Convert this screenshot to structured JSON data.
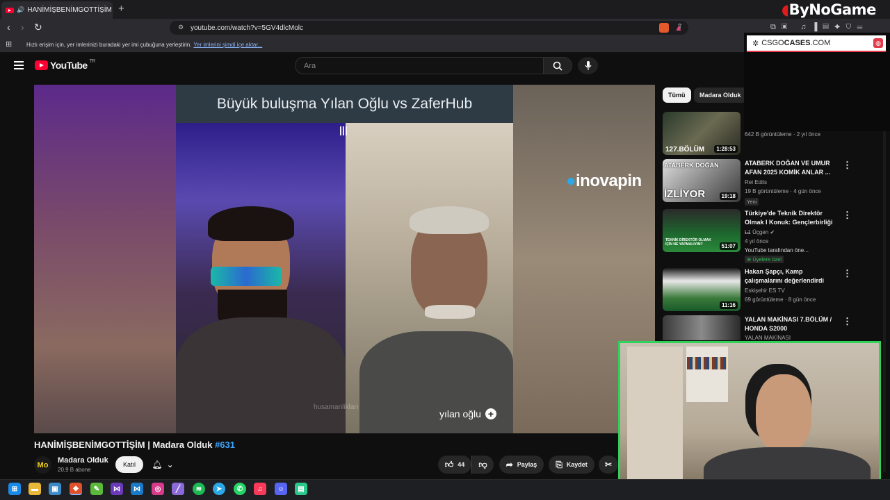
{
  "browser": {
    "tab_title": "HANİMİŞBENİMGOTTİŞİM | M",
    "tab_close": "✕",
    "new_tab": "+",
    "url": "youtube.com/watch?v=5GV4dlcMolc",
    "bookmarks_text": "Hızlı erişim için, yer imlerinizi buradaki yer imi çubuğuna yerleştirin.",
    "bookmarks_link": "Yer imlerini şimdi içe aktar..."
  },
  "overlay": {
    "brand": "ByNoGame"
  },
  "youtube": {
    "logo_text": "YouTube",
    "country_code": "TR",
    "search_placeholder": "Ara"
  },
  "video": {
    "banner_text": "Büyük buluşma Yılan Oğlu vs ZaferHub",
    "sponsor_text": "inovapin",
    "watermark": "husamanlikları",
    "name_tag": "yılan oğlu",
    "title": "HANİMİŞBENİMGOTTİŞİM | Madara Olduk",
    "title_tag": "#631",
    "channel_name": "Madara Olduk",
    "channel_initials": "Mo",
    "subscribers": "20,9 B abone",
    "join_label": "Katıl",
    "like_count": "44",
    "share_label": "Paylaş",
    "save_label": "Kaydet"
  },
  "ad": {
    "brand_pre": "CSGO",
    "brand_bold": "CASES",
    "brand_post": ".COM"
  },
  "sidebar": {
    "chips": [
      "Tümü",
      "Madara Olduk"
    ],
    "videos": [
      {
        "thumb_caption": "127.BÖLÜM",
        "duration": "1:28:53",
        "title": "",
        "channel": "",
        "meta": "642 B görüntüleme · 2 yıl önce"
      },
      {
        "thumb_caption": "ATABERK DOĞAN",
        "thumb_caption2": "İZLİYOR",
        "duration": "19:18",
        "title": "ATABERK DOĞAN VE UMUR AFAN 2025 KOMİK ANLAR ...",
        "channel": "Rei Edits",
        "meta": "19 B görüntüleme · 4 gün önce",
        "badge": "Yeni"
      },
      {
        "thumb_caption": "TEKNİK DİREKTÖR OLMAK İÇİN NE YAPMALIYIM?",
        "duration": "51:07",
        "title": "Türkiye'de Teknik Direktör Olmak I Konuk: Gençlerbirliği ...",
        "channel": "L1 Üçgen",
        "meta": "4 yıl önce",
        "extra": "YouTube tarafından öne...",
        "badge": "Üyelere özel"
      },
      {
        "thumb_caption": "",
        "duration": "11:16",
        "title": "Hakan Şapçı, Kamp çalışmalarını değerlendirdi",
        "channel": "Eskişehir ES TV",
        "meta": "69 görüntüleme · 8 gün önce"
      },
      {
        "thumb_caption": "",
        "duration": "",
        "title": "YALAN MAKİNASI 7.BÖLÜM / HONDA S2000",
        "channel": "YALAN MAKİNASI",
        "meta": ""
      }
    ]
  },
  "colors": {
    "accent_red": "#ff0033",
    "webcam_border": "#2fd35a",
    "link_blue": "#3ea6ff"
  }
}
